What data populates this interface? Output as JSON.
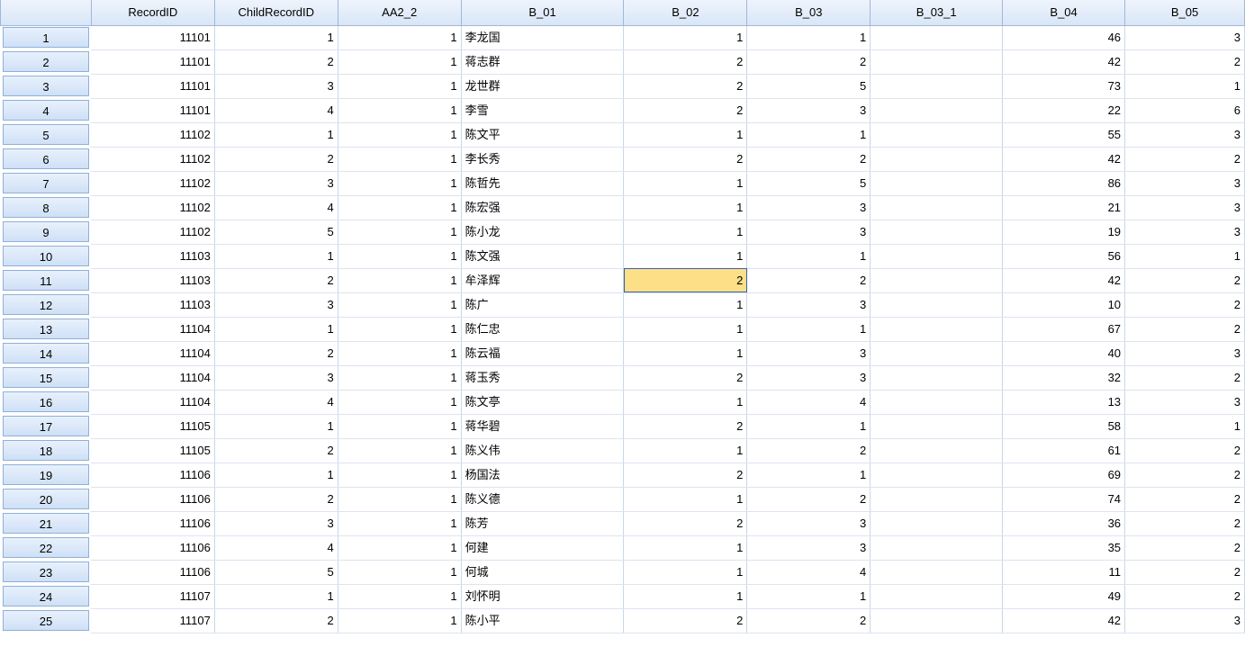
{
  "columns": [
    "RecordID",
    "ChildRecordID",
    "AA2_2",
    "B_01",
    "B_02",
    "B_03",
    "B_03_1",
    "B_04",
    "B_05"
  ],
  "rows": [
    {
      "n": "1",
      "RecordID": "11101",
      "ChildRecordID": "1",
      "AA2_2": "1",
      "B_01": "李龙国",
      "B_02": "1",
      "B_03": "1",
      "B_03_1": "",
      "B_04": "46",
      "B_05": "3"
    },
    {
      "n": "2",
      "RecordID": "11101",
      "ChildRecordID": "2",
      "AA2_2": "1",
      "B_01": "蒋志群",
      "B_02": "2",
      "B_03": "2",
      "B_03_1": "",
      "B_04": "42",
      "B_05": "2"
    },
    {
      "n": "3",
      "RecordID": "11101",
      "ChildRecordID": "3",
      "AA2_2": "1",
      "B_01": "龙世群",
      "B_02": "2",
      "B_03": "5",
      "B_03_1": "",
      "B_04": "73",
      "B_05": "1"
    },
    {
      "n": "4",
      "RecordID": "11101",
      "ChildRecordID": "4",
      "AA2_2": "1",
      "B_01": "李雪",
      "B_02": "2",
      "B_03": "3",
      "B_03_1": "",
      "B_04": "22",
      "B_05": "6"
    },
    {
      "n": "5",
      "RecordID": "11102",
      "ChildRecordID": "1",
      "AA2_2": "1",
      "B_01": "陈文平",
      "B_02": "1",
      "B_03": "1",
      "B_03_1": "",
      "B_04": "55",
      "B_05": "3"
    },
    {
      "n": "6",
      "RecordID": "11102",
      "ChildRecordID": "2",
      "AA2_2": "1",
      "B_01": "李长秀",
      "B_02": "2",
      "B_03": "2",
      "B_03_1": "",
      "B_04": "42",
      "B_05": "2"
    },
    {
      "n": "7",
      "RecordID": "11102",
      "ChildRecordID": "3",
      "AA2_2": "1",
      "B_01": "陈哲先",
      "B_02": "1",
      "B_03": "5",
      "B_03_1": "",
      "B_04": "86",
      "B_05": "3"
    },
    {
      "n": "8",
      "RecordID": "11102",
      "ChildRecordID": "4",
      "AA2_2": "1",
      "B_01": "陈宏强",
      "B_02": "1",
      "B_03": "3",
      "B_03_1": "",
      "B_04": "21",
      "B_05": "3"
    },
    {
      "n": "9",
      "RecordID": "11102",
      "ChildRecordID": "5",
      "AA2_2": "1",
      "B_01": "陈小龙",
      "B_02": "1",
      "B_03": "3",
      "B_03_1": "",
      "B_04": "19",
      "B_05": "3"
    },
    {
      "n": "10",
      "RecordID": "11103",
      "ChildRecordID": "1",
      "AA2_2": "1",
      "B_01": "陈文强",
      "B_02": "1",
      "B_03": "1",
      "B_03_1": "",
      "B_04": "56",
      "B_05": "1"
    },
    {
      "n": "11",
      "RecordID": "11103",
      "ChildRecordID": "2",
      "AA2_2": "1",
      "B_01": "牟泽辉",
      "B_02": "2",
      "B_03": "2",
      "B_03_1": "",
      "B_04": "42",
      "B_05": "2"
    },
    {
      "n": "12",
      "RecordID": "11103",
      "ChildRecordID": "3",
      "AA2_2": "1",
      "B_01": "陈广",
      "B_02": "1",
      "B_03": "3",
      "B_03_1": "",
      "B_04": "10",
      "B_05": "2"
    },
    {
      "n": "13",
      "RecordID": "11104",
      "ChildRecordID": "1",
      "AA2_2": "1",
      "B_01": "陈仁忠",
      "B_02": "1",
      "B_03": "1",
      "B_03_1": "",
      "B_04": "67",
      "B_05": "2"
    },
    {
      "n": "14",
      "RecordID": "11104",
      "ChildRecordID": "2",
      "AA2_2": "1",
      "B_01": "陈云福",
      "B_02": "1",
      "B_03": "3",
      "B_03_1": "",
      "B_04": "40",
      "B_05": "3"
    },
    {
      "n": "15",
      "RecordID": "11104",
      "ChildRecordID": "3",
      "AA2_2": "1",
      "B_01": "蒋玉秀",
      "B_02": "2",
      "B_03": "3",
      "B_03_1": "",
      "B_04": "32",
      "B_05": "2"
    },
    {
      "n": "16",
      "RecordID": "11104",
      "ChildRecordID": "4",
      "AA2_2": "1",
      "B_01": "陈文亭",
      "B_02": "1",
      "B_03": "4",
      "B_03_1": "",
      "B_04": "13",
      "B_05": "3"
    },
    {
      "n": "17",
      "RecordID": "11105",
      "ChildRecordID": "1",
      "AA2_2": "1",
      "B_01": "蒋华碧",
      "B_02": "2",
      "B_03": "1",
      "B_03_1": "",
      "B_04": "58",
      "B_05": "1"
    },
    {
      "n": "18",
      "RecordID": "11105",
      "ChildRecordID": "2",
      "AA2_2": "1",
      "B_01": "陈义伟",
      "B_02": "1",
      "B_03": "2",
      "B_03_1": "",
      "B_04": "61",
      "B_05": "2"
    },
    {
      "n": "19",
      "RecordID": "11106",
      "ChildRecordID": "1",
      "AA2_2": "1",
      "B_01": "杨国法",
      "B_02": "2",
      "B_03": "1",
      "B_03_1": "",
      "B_04": "69",
      "B_05": "2"
    },
    {
      "n": "20",
      "RecordID": "11106",
      "ChildRecordID": "2",
      "AA2_2": "1",
      "B_01": "陈义德",
      "B_02": "1",
      "B_03": "2",
      "B_03_1": "",
      "B_04": "74",
      "B_05": "2"
    },
    {
      "n": "21",
      "RecordID": "11106",
      "ChildRecordID": "3",
      "AA2_2": "1",
      "B_01": "陈芳",
      "B_02": "2",
      "B_03": "3",
      "B_03_1": "",
      "B_04": "36",
      "B_05": "2"
    },
    {
      "n": "22",
      "RecordID": "11106",
      "ChildRecordID": "4",
      "AA2_2": "1",
      "B_01": "何建",
      "B_02": "1",
      "B_03": "3",
      "B_03_1": "",
      "B_04": "35",
      "B_05": "2"
    },
    {
      "n": "23",
      "RecordID": "11106",
      "ChildRecordID": "5",
      "AA2_2": "1",
      "B_01": "何城",
      "B_02": "1",
      "B_03": "4",
      "B_03_1": "",
      "B_04": "11",
      "B_05": "2"
    },
    {
      "n": "24",
      "RecordID": "11107",
      "ChildRecordID": "1",
      "AA2_2": "1",
      "B_01": "刘怀明",
      "B_02": "1",
      "B_03": "1",
      "B_03_1": "",
      "B_04": "49",
      "B_05": "2"
    },
    {
      "n": "25",
      "RecordID": "11107",
      "ChildRecordID": "2",
      "AA2_2": "1",
      "B_01": "陈小平",
      "B_02": "2",
      "B_03": "2",
      "B_03_1": "",
      "B_04": "42",
      "B_05": "3"
    }
  ],
  "selected_cell": {
    "row_index": 10,
    "column": "B_02"
  },
  "colors": {
    "selected_cell_bg": "#fddf88",
    "header_bg": "#d9e6f7",
    "grid_line": "#c8d7eb"
  }
}
